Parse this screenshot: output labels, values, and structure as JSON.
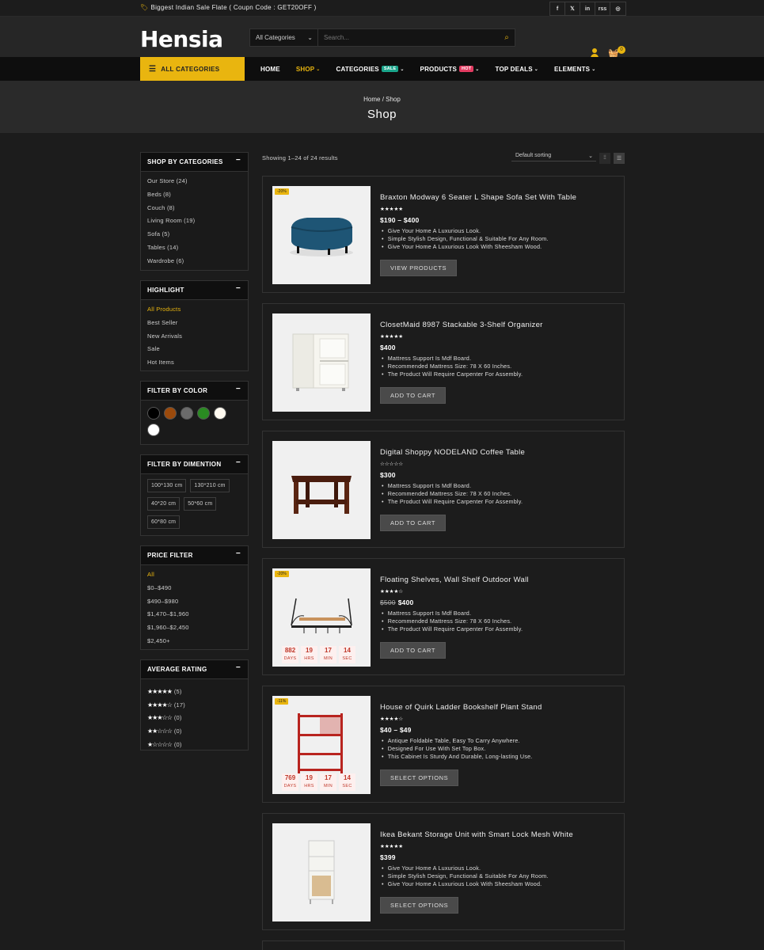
{
  "topbar": {
    "promo": "Biggest Indian Sale Flate ( Coupn Code : GET20OFF )",
    "social": [
      "f",
      "𝕏",
      "in",
      "rss",
      "◎"
    ]
  },
  "header": {
    "logo": "Hensia",
    "search_category": "All Categories",
    "search_placeholder": "Search...",
    "cart_count": "0"
  },
  "nav": {
    "all_categories": "ALL CATEGORIES",
    "items": [
      {
        "label": "HOME"
      },
      {
        "label": "SHOP"
      },
      {
        "label": "CATEGORIES",
        "pill": "SALE"
      },
      {
        "label": "PRODUCTS",
        "pill": "HOT"
      },
      {
        "label": "TOP DEALS"
      },
      {
        "label": "ELEMENTS"
      }
    ]
  },
  "banner": {
    "breadcrumb": "Home / Shop",
    "title": "Shop"
  },
  "sidebar": {
    "categories": {
      "title": "SHOP BY CATEGORIES",
      "items": [
        "Our Store (24)",
        "Beds (8)",
        "Couch (8)",
        "Living Room (19)",
        "Sofa (5)",
        "Tables (14)",
        "Wardrobe (6)"
      ]
    },
    "highlight": {
      "title": "HIGHLIGHT",
      "items": [
        "All Products",
        "Best Seller",
        "New Arrivals",
        "Sale",
        "Hot Items"
      ]
    },
    "color": {
      "title": "FILTER BY COLOR",
      "colors": [
        "#000000",
        "#9b4a0c",
        "#6b6b6b",
        "#2a8a22",
        "#fffaf0",
        "#ffffff"
      ]
    },
    "dimension": {
      "title": "FILTER BY DIMENTION",
      "items": [
        "100*130 cm",
        "130*210 cm",
        "40*20 cm",
        "50*60 cm",
        "60*80 cm"
      ]
    },
    "price": {
      "title": "PRICE FILTER",
      "items": [
        "All",
        "$0–$490",
        "$490–$980",
        "$1,470–$1,960",
        "$1,960–$2,450",
        "$2,450+"
      ]
    },
    "rating": {
      "title": "AVERAGE RATING",
      "items": [
        {
          "stars": "★★★★★",
          "count": "(5)"
        },
        {
          "stars": "★★★★☆",
          "count": "(17)"
        },
        {
          "stars": "★★★☆☆",
          "count": "(0)"
        },
        {
          "stars": "★★☆☆☆",
          "count": "(0)"
        },
        {
          "stars": "★☆☆☆☆",
          "count": "(0)"
        }
      ]
    }
  },
  "shop": {
    "results": "Showing 1–24 of 24 results",
    "sorting": "Default sorting"
  },
  "products": [
    {
      "name": "Braxton Modway 6 Seater L Shape Sofa Set With Table",
      "stars": "★★★★★",
      "price": "$190 – $400",
      "old_price": "",
      "discount": "-20%",
      "features": [
        "Give Your Home A Luxurious Look.",
        "Simple Stylish Design, Functional & Suitable For Any Room.",
        "Give Your Home A Luxurious Look With Sheesham Wood."
      ],
      "button": "VIEW PRODUCTS"
    },
    {
      "name": "ClosetMaid 8987 Stackable 3-Shelf Organizer",
      "stars": "★★★★★",
      "price": "$400",
      "old_price": "",
      "discount": "",
      "features": [
        "Mattress Support Is Mdf Board.",
        "Recommended Mattress Size: 78 X 60 Inches.",
        "The Product Will Require Carpenter For Assembly."
      ],
      "button": "ADD TO CART"
    },
    {
      "name": "Digital Shoppy NODELAND Coffee Table",
      "stars": "☆☆☆☆☆",
      "price": "$300",
      "old_price": "",
      "discount": "",
      "features": [
        "Mattress Support Is Mdf Board.",
        "Recommended Mattress Size: 78 X 60 Inches.",
        "The Product Will Require Carpenter For Assembly."
      ],
      "button": "ADD TO CART"
    },
    {
      "name": "Floating Shelves, Wall Shelf Outdoor Wall",
      "stars": "★★★★☆",
      "price": "$400",
      "old_price": "$500",
      "discount": "-20%",
      "features": [
        "Mattress Support Is Mdf Board.",
        "Recommended Mattress Size: 78 X 60 Inches.",
        "The Product Will Require Carpenter For Assembly."
      ],
      "button": "ADD TO CART",
      "timer": [
        {
          "n": "882",
          "u": "DAYS"
        },
        {
          "n": "19",
          "u": "HRS"
        },
        {
          "n": "17",
          "u": "MIN"
        },
        {
          "n": "14",
          "u": "SEC"
        }
      ]
    },
    {
      "name": "House of Quirk Ladder Bookshelf Plant Stand",
      "stars": "★★★★☆",
      "price": "$40 – $49",
      "old_price": "",
      "discount": "-11%",
      "features": [
        "Antique Foldable Table, Easy To Carry Anywhere.",
        "Designed For Use With Set Top Box.",
        "This Cabinet Is Sturdy And Durable, Long-lasting Use."
      ],
      "button": "SELECT OPTIONS",
      "timer": [
        {
          "n": "769",
          "u": "DAYS"
        },
        {
          "n": "19",
          "u": "HRS"
        },
        {
          "n": "17",
          "u": "MIN"
        },
        {
          "n": "14",
          "u": "SEC"
        }
      ]
    },
    {
      "name": "Ikea Bekant Storage Unit with Smart Lock Mesh White",
      "stars": "★★★★★",
      "price": "$399",
      "old_price": "",
      "discount": "",
      "features": [
        "Give Your Home A Luxurious Look.",
        "Simple Stylish Design, Functional & Suitable For Any Room.",
        "Give Your Home A Luxurious Look With Sheesham Wood."
      ],
      "button": "SELECT OPTIONS"
    }
  ]
}
